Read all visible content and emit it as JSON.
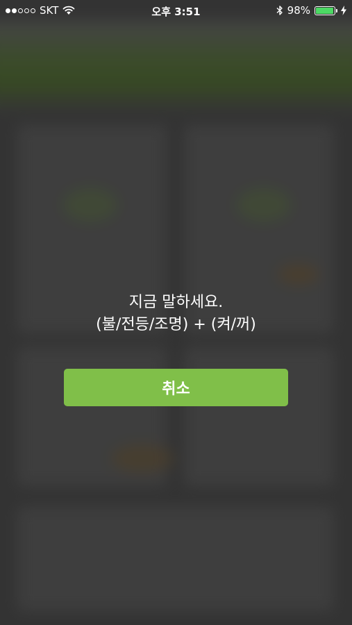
{
  "status_bar": {
    "carrier": "SKT",
    "time": "오후 3:51",
    "battery": "98%",
    "battery_level": 0.98,
    "signal_bars_filled": 2,
    "signal_bars_total": 5,
    "icons": [
      "signal-dots-icon",
      "wifi-icon",
      "bluetooth-icon",
      "battery-icon",
      "charging-bolt-icon"
    ],
    "battery_color": "#4cd964"
  },
  "voice_prompt": {
    "line1": "지금 말하세요.",
    "line2": "(불/전등/조명) + (켜/꺼)"
  },
  "cancel_button": {
    "label": "취소",
    "color": "#80bf49"
  }
}
